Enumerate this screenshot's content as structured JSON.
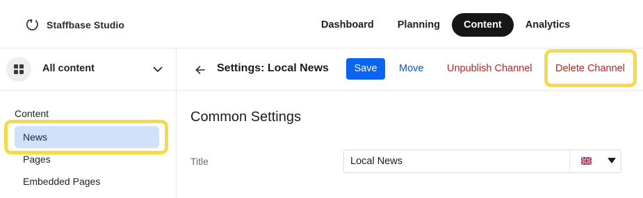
{
  "app": {
    "name": "Staffbase Studio"
  },
  "nav": {
    "items": [
      {
        "label": "Dashboard",
        "active": false
      },
      {
        "label": "Planning",
        "active": false
      },
      {
        "label": "Content",
        "active": true
      },
      {
        "label": "Analytics",
        "active": false
      }
    ]
  },
  "sidebar": {
    "scope_label": "All content",
    "scope_icon": "grid-icon",
    "section_title": "Content",
    "items": [
      {
        "label": "News",
        "selected": true
      },
      {
        "label": "Pages",
        "selected": false
      },
      {
        "label": "Embedded Pages",
        "selected": false
      }
    ]
  },
  "toolbar": {
    "title": "Settings: Local News",
    "save_label": "Save",
    "move_label": "Move",
    "unpublish_label": "Unpublish Channel",
    "delete_label": "Delete Channel"
  },
  "settings": {
    "heading": "Common Settings",
    "title_label": "Title",
    "title_value": "Local News",
    "language_flag": "uk-flag-icon"
  },
  "colors": {
    "accent": "#0a64f0",
    "link": "#1052c6",
    "danger": "#b3261e",
    "highlight": "#f7d94c",
    "selected_bg": "#cfe2fa",
    "active_nav_bg": "#161616"
  }
}
